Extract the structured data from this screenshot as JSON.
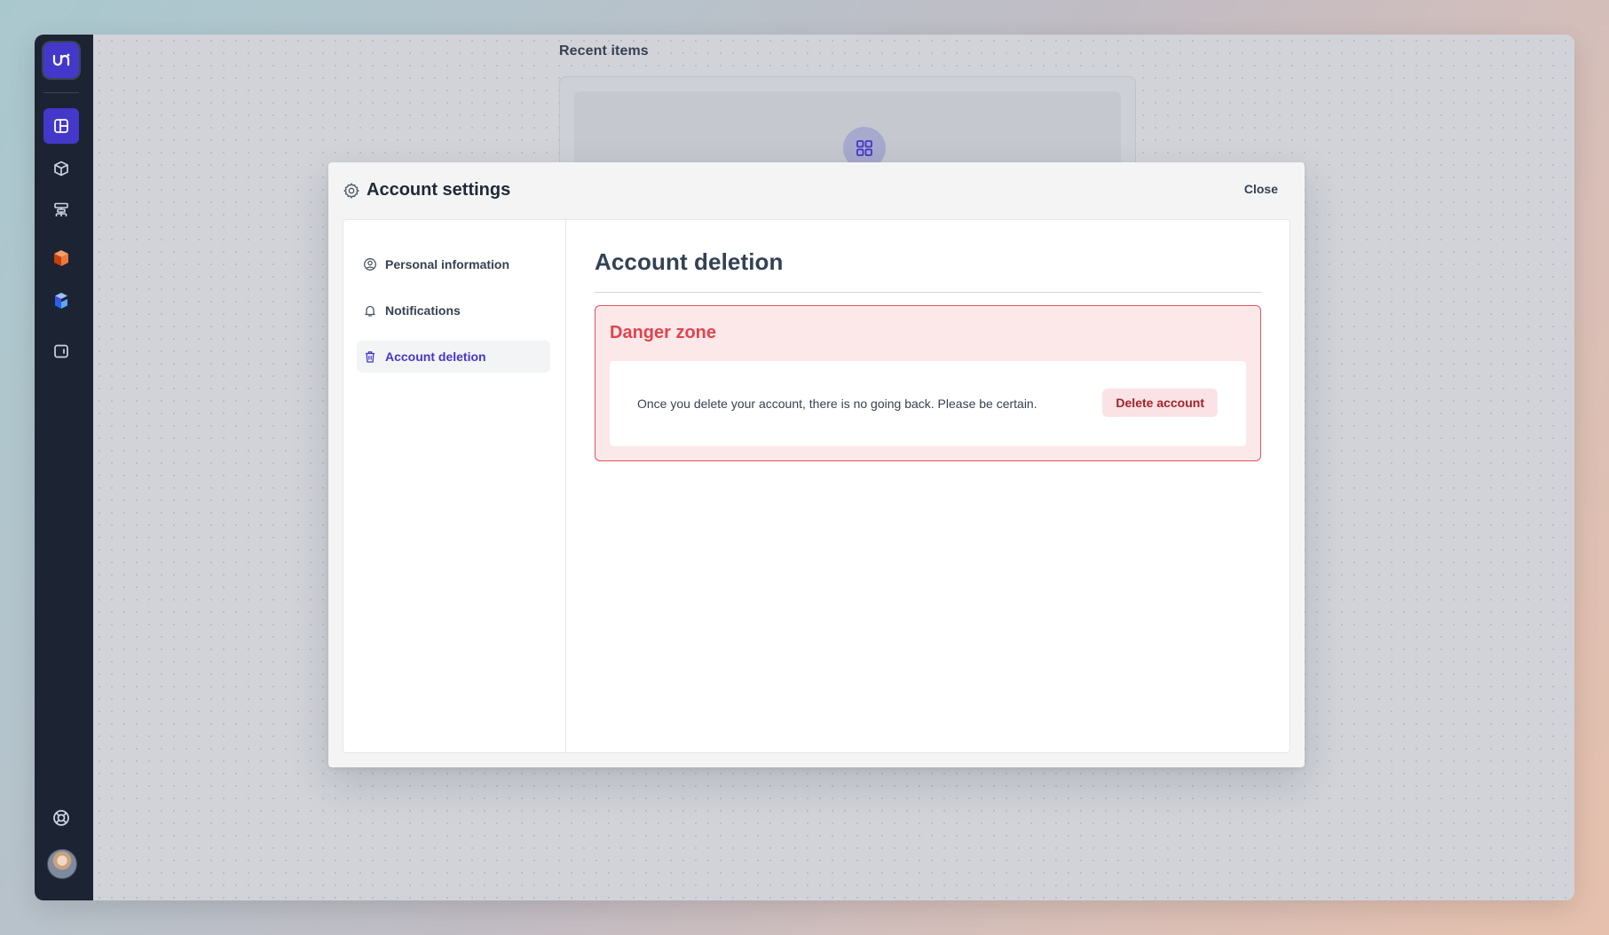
{
  "rail": {
    "logo_text": "ui",
    "icons": [
      "layout-icon",
      "box-icon",
      "hierarchy-icon",
      "orange-cube-icon",
      "blue-cube-icon",
      "tablet-icon"
    ],
    "help_icon": "lifebuoy-icon",
    "avatar": "user-avatar"
  },
  "background": {
    "recent_title": "Recent items"
  },
  "modal": {
    "title": "Account settings",
    "close_label": "Close",
    "nav": [
      {
        "label": "Personal information",
        "icon": "user-circle-icon"
      },
      {
        "label": "Notifications",
        "icon": "bell-icon"
      },
      {
        "label": "Account deletion",
        "icon": "trash-icon",
        "active": true
      }
    ],
    "content": {
      "title": "Account deletion",
      "danger_title": "Danger zone",
      "danger_text": "Once you delete your account, there is no going back. Please be certain.",
      "delete_label": "Delete account"
    }
  },
  "colors": {
    "accent": "#4338ca",
    "danger": "#e0444d",
    "danger_bg": "#fce8e9",
    "rail_bg": "#1c2333"
  }
}
